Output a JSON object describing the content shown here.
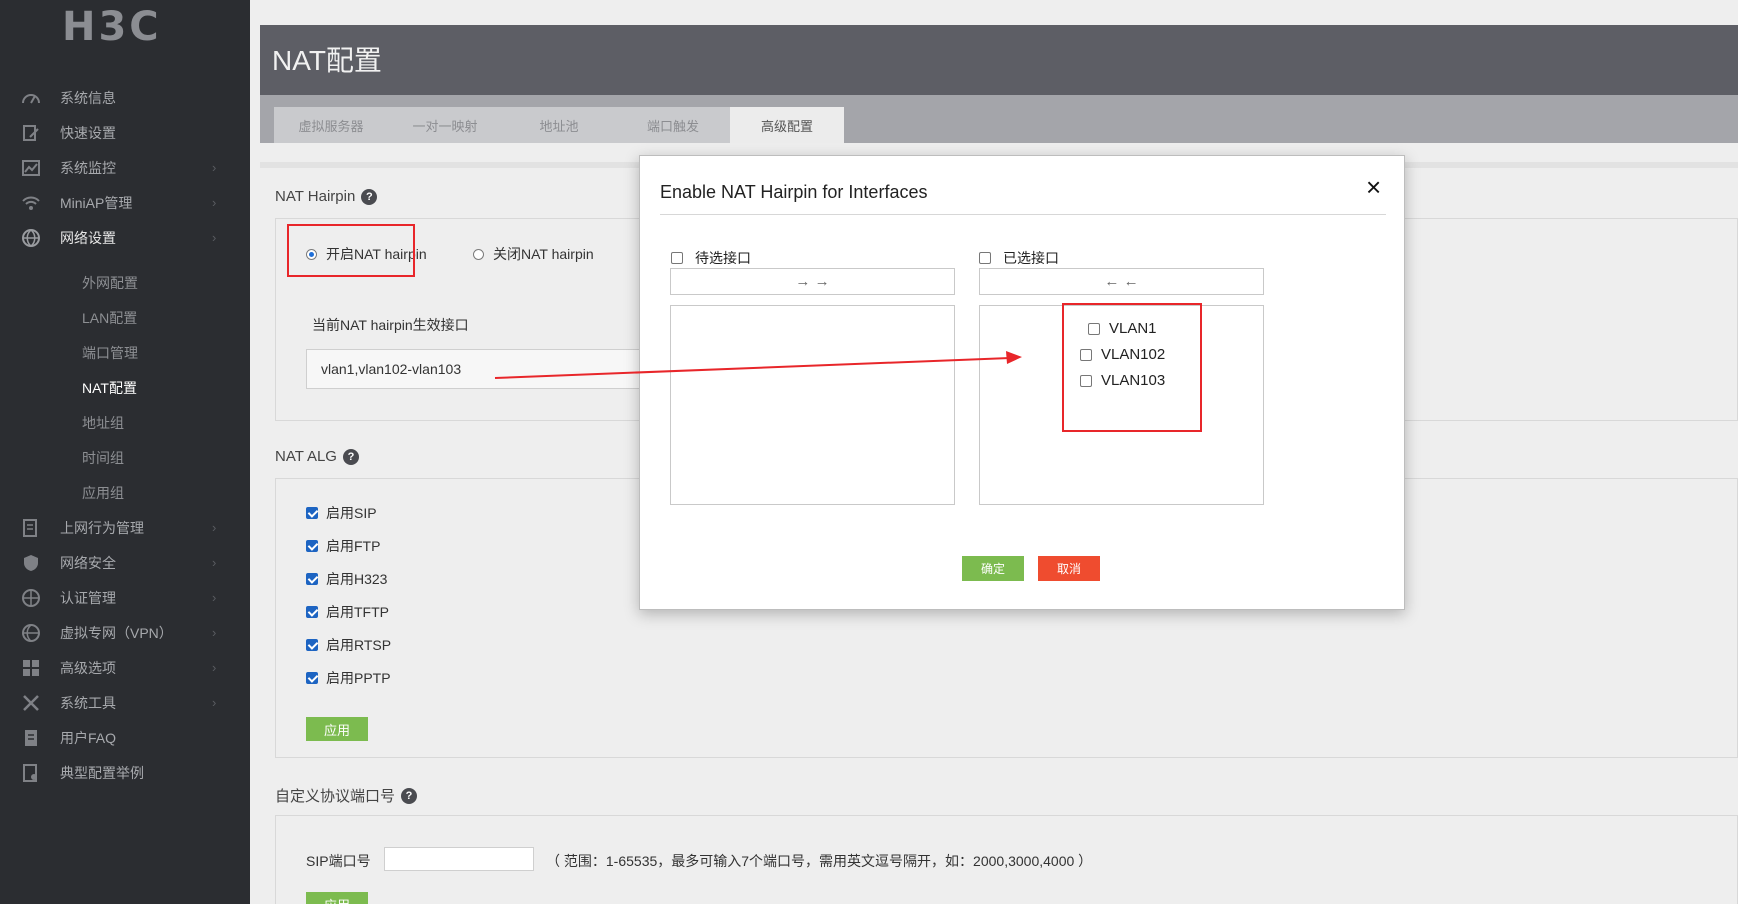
{
  "brand": {
    "logo": "H3C"
  },
  "sidebar": {
    "items": [
      {
        "label": "系统信息",
        "icon": "speedometer-icon",
        "arrow": ""
      },
      {
        "label": "快速设置",
        "icon": "edit-document-icon",
        "arrow": ""
      },
      {
        "label": "系统监控",
        "icon": "chart-monitor-icon",
        "arrow": "›"
      },
      {
        "label": "MiniAP管理",
        "icon": "wifi-icon",
        "arrow": "›"
      },
      {
        "label": "网络设置",
        "icon": "globe-icon",
        "arrow": "›"
      },
      {
        "label": "上网行为管理",
        "icon": "document-list-icon",
        "arrow": "›"
      },
      {
        "label": "网络安全",
        "icon": "shield-icon",
        "arrow": "›"
      },
      {
        "label": "认证管理",
        "icon": "globe-check-icon",
        "arrow": "›"
      },
      {
        "label": "虚拟专网（VPN）",
        "icon": "globe-vpn-icon",
        "arrow": "›"
      },
      {
        "label": "高级选项",
        "icon": "grid-icon",
        "arrow": "›"
      },
      {
        "label": "系统工具",
        "icon": "tools-icon",
        "arrow": "›"
      },
      {
        "label": "用户FAQ",
        "icon": "document-icon",
        "arrow": ""
      },
      {
        "label": "典型配置举例",
        "icon": "settings-doc-icon",
        "arrow": ""
      }
    ],
    "network_sub": [
      "外网配置",
      "LAN配置",
      "端口管理",
      "NAT配置",
      "地址组",
      "时间组",
      "应用组"
    ]
  },
  "page": {
    "title": "NAT配置"
  },
  "tabs": [
    "虚拟服务器",
    "一对一映射",
    "地址池",
    "端口触发",
    "高级配置"
  ],
  "hairpin": {
    "section_title": "NAT Hairpin",
    "enable_label": "开启NAT hairpin",
    "disable_label": "关闭NAT hairpin",
    "current_label": "当前NAT hairpin生效接口",
    "current_value": "vlan1,vlan102-vlan103"
  },
  "alg": {
    "section_title": "NAT ALG",
    "options": [
      "启用SIP",
      "启用FTP",
      "启用H323",
      "启用TFTP",
      "启用RTSP",
      "启用PPTP"
    ],
    "apply_label": "应用"
  },
  "custom_port": {
    "section_title": "自定义协议端口号",
    "sip_label": "SIP端口号",
    "sip_value": "",
    "hint": "（ 范围：1-65535，最多可输入7个端口号，需用英文逗号隔开，如：2000,3000,4000 ）",
    "apply_label": "应用"
  },
  "modal": {
    "title": "Enable NAT Hairpin for Interfaces",
    "close": "×",
    "available_label": "待选接口",
    "selected_label": "已选接口",
    "move_right": "→ →",
    "move_left": "← ←",
    "selected_items": [
      "VLAN1",
      "VLAN102",
      "VLAN103"
    ],
    "confirm_label": "确定",
    "cancel_label": "取消"
  },
  "colors": {
    "sidebar_bg": "#2b2d31",
    "header_bg": "#5d5e65",
    "accent_green": "#7cbb4f",
    "cancel_red": "#ef4c2f",
    "annotation_red": "#e8262a"
  }
}
